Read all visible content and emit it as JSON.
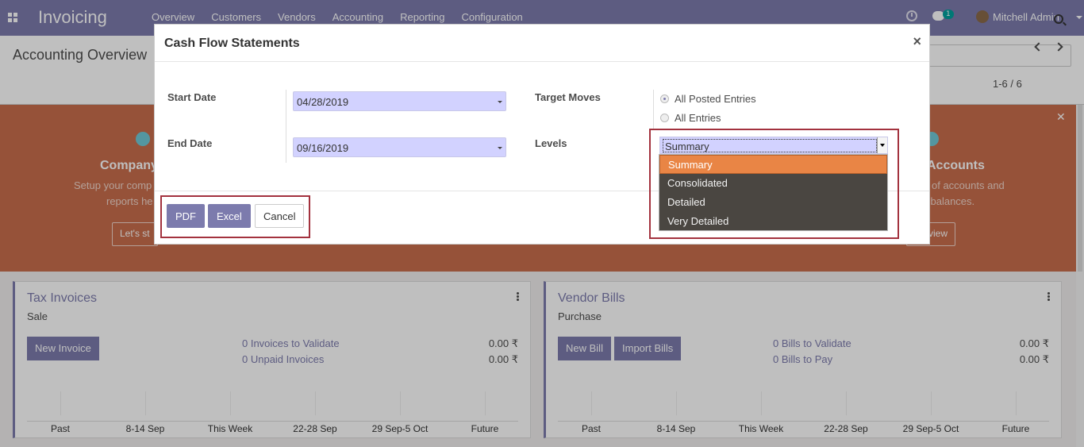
{
  "app": {
    "title": "Invoicing",
    "menu": [
      "Overview",
      "Customers",
      "Vendors",
      "Accounting",
      "Reporting",
      "Configuration"
    ],
    "chat_count": "1",
    "user": "Mitchell Admin"
  },
  "control_panel": {
    "breadcrumb": "Accounting Overview",
    "pager": "1-6 / 6"
  },
  "banner": {
    "left_title": "Company",
    "left_text_1": "Setup your comp",
    "left_text_2": "reports he",
    "left_button": "Let's st",
    "right_title": "Accounts",
    "right_text_1": "of accounts and",
    "right_text_2": "l balances.",
    "right_button": "view"
  },
  "cards": [
    {
      "title": "Tax Invoices",
      "subtitle": "Sale",
      "buttons": [
        "New Invoice"
      ],
      "links": [
        "0 Invoices to Validate",
        "0 Unpaid Invoices"
      ],
      "amounts": [
        "0.00 ₹",
        "0.00 ₹"
      ],
      "graph_labels": [
        "Past",
        "8-14 Sep",
        "This Week",
        "22-28 Sep",
        "29 Sep-5 Oct",
        "Future"
      ]
    },
    {
      "title": "Vendor Bills",
      "subtitle": "Purchase",
      "buttons": [
        "New Bill",
        "Import Bills"
      ],
      "links": [
        "0 Bills to Validate",
        "0 Bills to Pay"
      ],
      "amounts": [
        "0.00 ₹",
        "0.00 ₹"
      ],
      "graph_labels": [
        "Past",
        "8-14 Sep",
        "This Week",
        "22-28 Sep",
        "29 Sep-5 Oct",
        "Future"
      ]
    }
  ],
  "modal": {
    "title": "Cash Flow Statements",
    "close": "×",
    "start_date_label": "Start Date",
    "start_date": "04/28/2019",
    "end_date_label": "End Date",
    "end_date": "09/16/2019",
    "target_moves_label": "Target Moves",
    "target_moves_options": [
      "All Posted Entries",
      "All Entries"
    ],
    "levels_label": "Levels",
    "levels_selected": "Summary",
    "levels_options": [
      "Summary",
      "Consolidated",
      "Detailed",
      "Very Detailed"
    ],
    "buttons": {
      "pdf": "PDF",
      "excel": "Excel",
      "cancel": "Cancel"
    }
  },
  "colors": {
    "brand": "#7c7bad",
    "banner": "#c86e4d",
    "highlight": "#a3323e",
    "dropdown_active": "#e98545"
  }
}
